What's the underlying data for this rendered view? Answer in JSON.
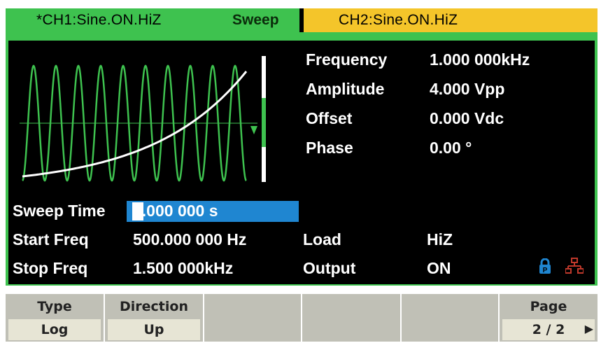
{
  "header": {
    "ch1_label": "*CH1:Sine.ON.HiZ",
    "ch1_mode": "Sweep",
    "ch2_label": "CH2:Sine.ON.HiZ"
  },
  "params_right": [
    {
      "label": "Frequency",
      "value": "1.000 000kHz"
    },
    {
      "label": "Amplitude",
      "value": "4.000 Vpp"
    },
    {
      "label": "Offset",
      "value": "0.000 Vdc"
    },
    {
      "label": "Phase",
      "value": "0.00 °"
    }
  ],
  "params_left": [
    {
      "label": "Sweep Time",
      "value": "1.000 000 s"
    },
    {
      "label": "Start Freq",
      "value": "500.000 000 Hz"
    },
    {
      "label": "Stop Freq",
      "value": "1.500 000kHz"
    }
  ],
  "params_bottom_right": [
    {
      "label": "Load",
      "value": "HiZ"
    },
    {
      "label": "Output",
      "value": "ON"
    }
  ],
  "softkeys": [
    {
      "title": "Type",
      "value": "Log"
    },
    {
      "title": "Direction",
      "value": "Up"
    },
    {
      "title": "",
      "value": ""
    },
    {
      "title": "",
      "value": ""
    },
    {
      "title": "",
      "value": ""
    },
    {
      "title": "Page",
      "value": "2 / 2"
    }
  ],
  "icons": {
    "lock": "lock-icon",
    "network": "network-icon",
    "page_arrow": "▶"
  },
  "colors": {
    "ch1_tab": "#3ec24f",
    "ch2_tab": "#f4c52a",
    "selected_field": "#1f86d1",
    "wave": "#3ec24f"
  }
}
